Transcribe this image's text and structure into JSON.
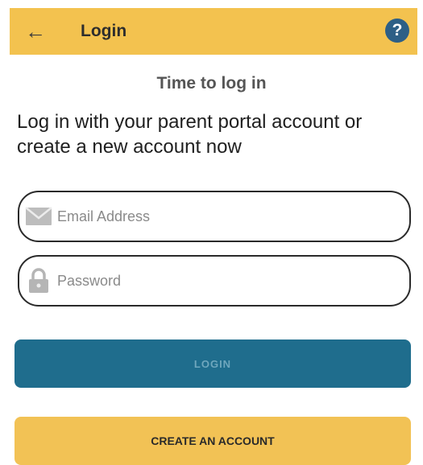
{
  "app_bar": {
    "title": "Login",
    "back_icon": "arrow-left-icon",
    "help_icon": "help-icon",
    "help_glyph": "?",
    "background_color": "#f3c24f",
    "help_color": "#2d5f86"
  },
  "heading": "Time to log in",
  "intro": "Log in with your parent portal account or create a new account now",
  "form": {
    "email": {
      "icon": "mail-icon",
      "placeholder": "Email Address",
      "value": ""
    },
    "password": {
      "icon": "lock-icon",
      "placeholder": "Password",
      "value": ""
    }
  },
  "buttons": {
    "login_label": "LOGIN",
    "create_label": "CREATE AN ACCOUNT",
    "login_color": "#1f6d8d",
    "create_color": "#f2c255"
  }
}
